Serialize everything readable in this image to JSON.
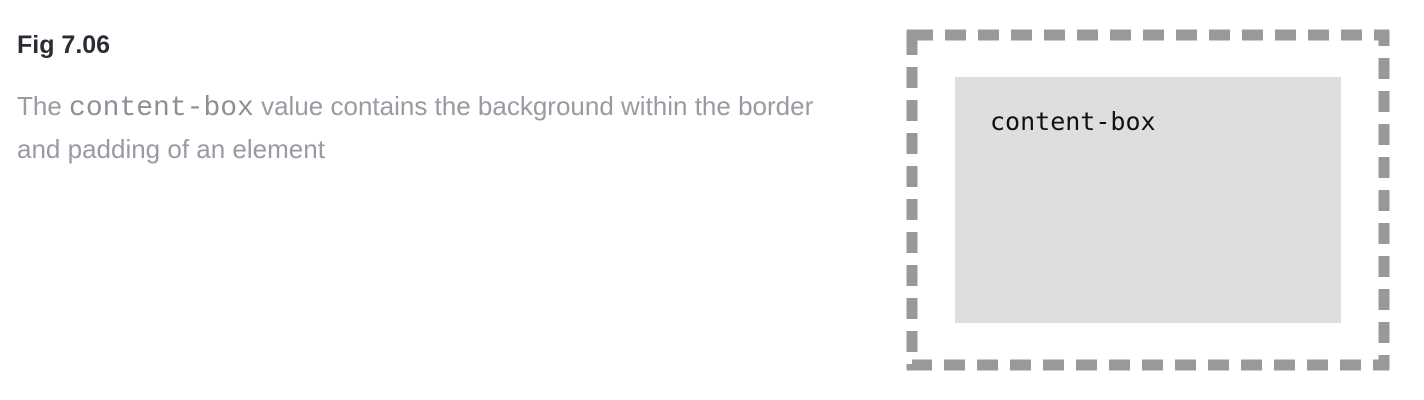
{
  "figure": {
    "number": "Fig 7.06",
    "caption_before": "The ",
    "caption_code": "content-box",
    "caption_after": " value contains the background within the border and padding of an element"
  },
  "diagram": {
    "box_label": "content-box",
    "border_color": "#999999",
    "content_background": "#dedede"
  }
}
